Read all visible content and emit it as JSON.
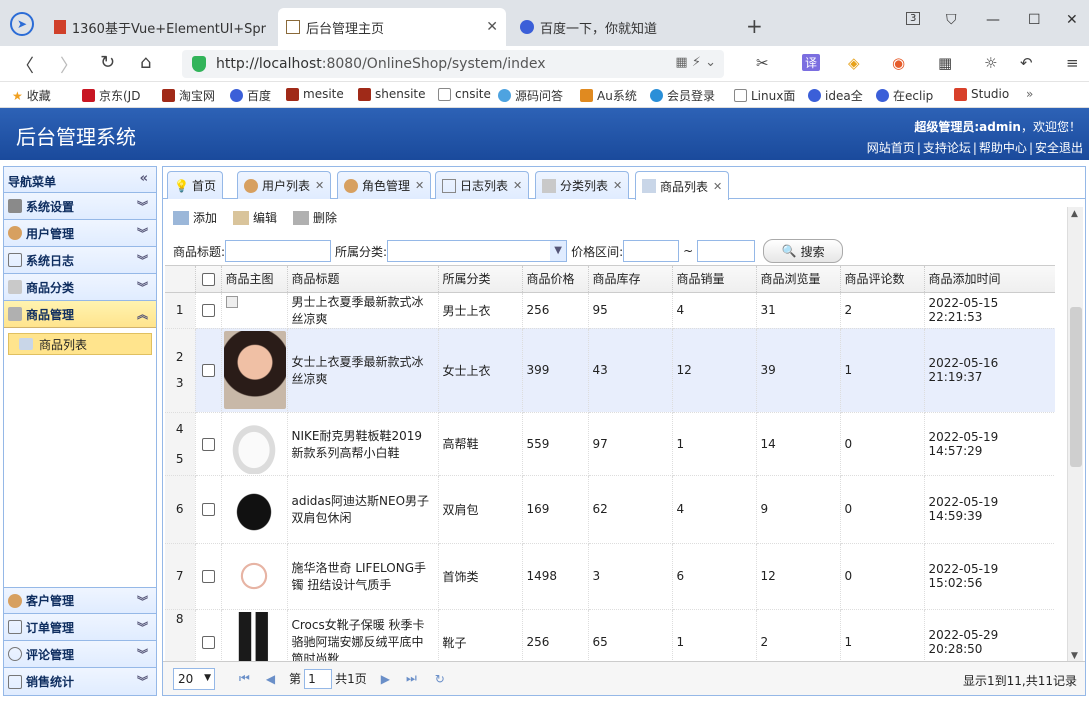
{
  "browser": {
    "tabs": [
      {
        "title": "1360基于Vue+ElementUI+Spr",
        "color": "#d0402a"
      },
      {
        "title": "后台管理主页",
        "color": "#8a6a3a"
      },
      {
        "title": "百度一下，你就知道",
        "color": "#3b5fd8"
      }
    ],
    "url_host": "http://localhost",
    "url_rest": ":8080/OnlineShop/system/index",
    "bookmarks": [
      "收藏",
      "京东(JD",
      "淘宝网",
      "百度",
      "mesite",
      "shensite",
      "cnsite",
      "源码问答",
      "Au系统",
      "会员登录",
      "Linux面",
      "idea全",
      "在eclip",
      "Studio"
    ]
  },
  "header": {
    "title": "后台管理系统",
    "welcome_user": "超级管理员:admin",
    "welcome_suffix": "，欢迎您！",
    "links": [
      "网站首页",
      "支持论坛",
      "帮助中心",
      "安全退出"
    ]
  },
  "sidebar": {
    "title": "导航菜单",
    "items": [
      "系统设置",
      "用户管理",
      "系统日志",
      "商品分类",
      "商品管理"
    ],
    "active_sub": "商品列表",
    "bottom_items": [
      "客户管理",
      "订单管理",
      "评论管理",
      "销售统计"
    ]
  },
  "tabs": [
    "首页",
    "用户列表",
    "角色管理",
    "日志列表",
    "分类列表",
    "商品列表"
  ],
  "toolbar": {
    "add": "添加",
    "edit": "编辑",
    "delete": "删除"
  },
  "search": {
    "title_label": "商品标题:",
    "category_label": "所属分类:",
    "price_label": "价格区间:",
    "tilde": "~",
    "button": "搜索"
  },
  "grid": {
    "columns": [
      "商品主图",
      "商品标题",
      "所属分类",
      "商品价格",
      "商品库存",
      "商品销量",
      "商品浏览量",
      "商品评论数",
      "商品添加时间"
    ],
    "rows": [
      {
        "num": "1",
        "img": "broken",
        "title": "男士上衣夏季最新款式冰丝凉爽",
        "cat": "男士上衣",
        "price": "256",
        "stock": "95",
        "sales": "4",
        "views": "31",
        "comments": "2",
        "time": "2022-05-15 22:21:53"
      },
      {
        "num": "2",
        "num2": "3",
        "img": "face",
        "title": "女士上衣夏季最新款式冰丝凉爽",
        "cat": "女士上衣",
        "price": "399",
        "stock": "43",
        "sales": "12",
        "views": "39",
        "comments": "1",
        "time": "2022-05-16 21:19:37"
      },
      {
        "num": "4",
        "num2": "5",
        "img": "shoe",
        "title": "NIKE耐克男鞋板鞋2019新款系列高帮小白鞋",
        "cat": "高帮鞋",
        "price": "559",
        "stock": "97",
        "sales": "1",
        "views": "14",
        "comments": "0",
        "time": "2022-05-19 14:57:29"
      },
      {
        "num": "6",
        "img": "bag",
        "title": "adidas阿迪达斯NEO男子双肩包休闲",
        "cat": "双肩包",
        "price": "169",
        "stock": "62",
        "sales": "4",
        "views": "9",
        "comments": "0",
        "time": "2022-05-19 14:59:39"
      },
      {
        "num": "7",
        "img": "chain",
        "title": "施华洛世奇 LIFELONG手镯 扭结设计气质手",
        "cat": "首饰类",
        "price": "1498",
        "stock": "3",
        "sales": "6",
        "views": "12",
        "comments": "0",
        "time": "2022-05-19 15:02:56"
      },
      {
        "num": "8",
        "img": "boot",
        "title": "Crocs女靴子保暖 秋季卡骆驰阿瑞安娜反绒平底中筒时尚靴",
        "cat": "靴子",
        "price": "256",
        "stock": "65",
        "sales": "1",
        "views": "2",
        "comments": "1",
        "time": "2022-05-29 20:28:50"
      }
    ]
  },
  "pager": {
    "page_size": "20",
    "page_prefix": "第",
    "page": "1",
    "total_pages": "共1页",
    "info": "显示1到11,共11记录"
  }
}
